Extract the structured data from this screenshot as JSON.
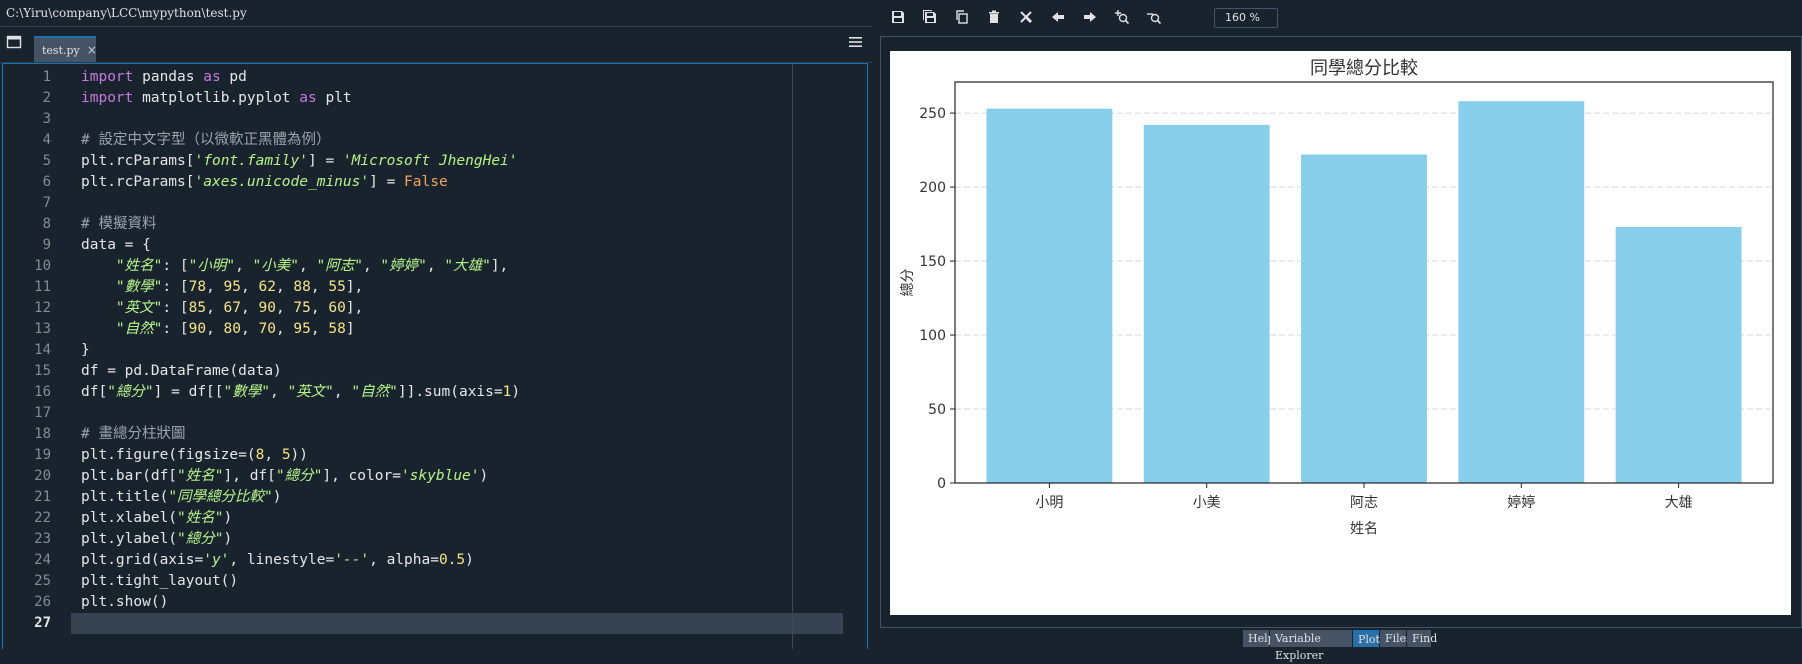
{
  "editor": {
    "file_path": "C:\\Yiru\\company\\LCC\\mypython\\test.py",
    "tab": {
      "label": "test.py",
      "close_glyph": "×"
    },
    "icons": {
      "browse_tabs": "browse-tabs-icon",
      "options": "hamburger-menu-icon"
    },
    "line_numbers": [
      "1",
      "2",
      "3",
      "4",
      "5",
      "6",
      "7",
      "8",
      "9",
      "10",
      "11",
      "12",
      "13",
      "14",
      "15",
      "16",
      "17",
      "18",
      "19",
      "20",
      "21",
      "22",
      "23",
      "24",
      "25",
      "26",
      "27"
    ],
    "current_line": 27,
    "code": [
      [
        {
          "t": "kw",
          "v": "import"
        },
        {
          "t": "p",
          "v": " pandas "
        },
        {
          "t": "kw",
          "v": "as"
        },
        {
          "t": "p",
          "v": " pd"
        }
      ],
      [
        {
          "t": "kw",
          "v": "import"
        },
        {
          "t": "p",
          "v": " matplotlib.pyplot "
        },
        {
          "t": "kw",
          "v": "as"
        },
        {
          "t": "p",
          "v": " plt"
        }
      ],
      [],
      [
        {
          "t": "cmt",
          "v": "# 設定中文字型（以微軟正黑體為例）"
        }
      ],
      [
        {
          "t": "p",
          "v": "plt.rcParams["
        },
        {
          "t": "str",
          "v": "'font.family'"
        },
        {
          "t": "p",
          "v": "] = "
        },
        {
          "t": "str",
          "v": "'Microsoft JhengHei'"
        }
      ],
      [
        {
          "t": "p",
          "v": "plt.rcParams["
        },
        {
          "t": "str",
          "v": "'axes.unicode_minus'"
        },
        {
          "t": "p",
          "v": "] = "
        },
        {
          "t": "bool",
          "v": "False"
        }
      ],
      [],
      [
        {
          "t": "cmt",
          "v": "# 模擬資料"
        }
      ],
      [
        {
          "t": "p",
          "v": "data = {"
        }
      ],
      [
        {
          "t": "p",
          "v": "    "
        },
        {
          "t": "str",
          "v": "\"姓名\""
        },
        {
          "t": "p",
          "v": ": ["
        },
        {
          "t": "str",
          "v": "\"小明\""
        },
        {
          "t": "p",
          "v": ", "
        },
        {
          "t": "str",
          "v": "\"小美\""
        },
        {
          "t": "p",
          "v": ", "
        },
        {
          "t": "str",
          "v": "\"阿志\""
        },
        {
          "t": "p",
          "v": ", "
        },
        {
          "t": "str",
          "v": "\"婷婷\""
        },
        {
          "t": "p",
          "v": ", "
        },
        {
          "t": "str",
          "v": "\"大雄\""
        },
        {
          "t": "p",
          "v": "],"
        }
      ],
      [
        {
          "t": "p",
          "v": "    "
        },
        {
          "t": "str",
          "v": "\"數學\""
        },
        {
          "t": "p",
          "v": ": ["
        },
        {
          "t": "num",
          "v": "78"
        },
        {
          "t": "p",
          "v": ", "
        },
        {
          "t": "num",
          "v": "95"
        },
        {
          "t": "p",
          "v": ", "
        },
        {
          "t": "num",
          "v": "62"
        },
        {
          "t": "p",
          "v": ", "
        },
        {
          "t": "num",
          "v": "88"
        },
        {
          "t": "p",
          "v": ", "
        },
        {
          "t": "num",
          "v": "55"
        },
        {
          "t": "p",
          "v": "],"
        }
      ],
      [
        {
          "t": "p",
          "v": "    "
        },
        {
          "t": "str",
          "v": "\"英文\""
        },
        {
          "t": "p",
          "v": ": ["
        },
        {
          "t": "num",
          "v": "85"
        },
        {
          "t": "p",
          "v": ", "
        },
        {
          "t": "num",
          "v": "67"
        },
        {
          "t": "p",
          "v": ", "
        },
        {
          "t": "num",
          "v": "90"
        },
        {
          "t": "p",
          "v": ", "
        },
        {
          "t": "num",
          "v": "75"
        },
        {
          "t": "p",
          "v": ", "
        },
        {
          "t": "num",
          "v": "60"
        },
        {
          "t": "p",
          "v": "],"
        }
      ],
      [
        {
          "t": "p",
          "v": "    "
        },
        {
          "t": "str",
          "v": "\"自然\""
        },
        {
          "t": "p",
          "v": ": ["
        },
        {
          "t": "num",
          "v": "90"
        },
        {
          "t": "p",
          "v": ", "
        },
        {
          "t": "num",
          "v": "80"
        },
        {
          "t": "p",
          "v": ", "
        },
        {
          "t": "num",
          "v": "70"
        },
        {
          "t": "p",
          "v": ", "
        },
        {
          "t": "num",
          "v": "95"
        },
        {
          "t": "p",
          "v": ", "
        },
        {
          "t": "num",
          "v": "58"
        },
        {
          "t": "p",
          "v": "]"
        }
      ],
      [
        {
          "t": "p",
          "v": "}"
        }
      ],
      [
        {
          "t": "p",
          "v": "df = pd.DataFrame(data)"
        }
      ],
      [
        {
          "t": "p",
          "v": "df["
        },
        {
          "t": "str",
          "v": "\"總分\""
        },
        {
          "t": "p",
          "v": "] = df[["
        },
        {
          "t": "str",
          "v": "\"數學\""
        },
        {
          "t": "p",
          "v": ", "
        },
        {
          "t": "str",
          "v": "\"英文\""
        },
        {
          "t": "p",
          "v": ", "
        },
        {
          "t": "str",
          "v": "\"自然\""
        },
        {
          "t": "p",
          "v": "]].sum(axis="
        },
        {
          "t": "num",
          "v": "1"
        },
        {
          "t": "p",
          "v": ")"
        }
      ],
      [],
      [
        {
          "t": "cmt",
          "v": "# 畫總分柱狀圖"
        }
      ],
      [
        {
          "t": "p",
          "v": "plt.figure(figsize=("
        },
        {
          "t": "num",
          "v": "8"
        },
        {
          "t": "p",
          "v": ", "
        },
        {
          "t": "num",
          "v": "5"
        },
        {
          "t": "p",
          "v": "))"
        }
      ],
      [
        {
          "t": "p",
          "v": "plt.bar(df["
        },
        {
          "t": "str",
          "v": "\"姓名\""
        },
        {
          "t": "p",
          "v": "], df["
        },
        {
          "t": "str",
          "v": "\"總分\""
        },
        {
          "t": "p",
          "v": "], color="
        },
        {
          "t": "str",
          "v": "'skyblue'"
        },
        {
          "t": "p",
          "v": ")"
        }
      ],
      [
        {
          "t": "p",
          "v": "plt.title("
        },
        {
          "t": "str",
          "v": "\"同學總分比較\""
        },
        {
          "t": "p",
          "v": ")"
        }
      ],
      [
        {
          "t": "p",
          "v": "plt.xlabel("
        },
        {
          "t": "str",
          "v": "\"姓名\""
        },
        {
          "t": "p",
          "v": ")"
        }
      ],
      [
        {
          "t": "p",
          "v": "plt.ylabel("
        },
        {
          "t": "str",
          "v": "\"總分\""
        },
        {
          "t": "p",
          "v": ")"
        }
      ],
      [
        {
          "t": "p",
          "v": "plt.grid(axis="
        },
        {
          "t": "str",
          "v": "'y'"
        },
        {
          "t": "p",
          "v": ", linestyle="
        },
        {
          "t": "str",
          "v": "'--'"
        },
        {
          "t": "p",
          "v": ", alpha="
        },
        {
          "t": "num",
          "v": "0.5"
        },
        {
          "t": "p",
          "v": ")"
        }
      ],
      [
        {
          "t": "p",
          "v": "plt.tight_layout()"
        }
      ],
      [
        {
          "t": "p",
          "v": "plt.show()"
        }
      ],
      []
    ],
    "colors": {
      "keyword": "#c678dd",
      "string": "#b5f38a",
      "number": "#f5e387",
      "comment": "#9aa3ab",
      "boolean": "#f0a55a",
      "plain": "#e6e6e6"
    }
  },
  "plots": {
    "toolbar": [
      {
        "name": "save-plot-button",
        "icon": "save-icon"
      },
      {
        "name": "save-all-plots-button",
        "icon": "save-all-icon"
      },
      {
        "name": "copy-plot-button",
        "icon": "copy-icon"
      },
      {
        "name": "remove-plot-button",
        "icon": "trash-icon"
      },
      {
        "name": "remove-all-plots-button",
        "icon": "remove-all-icon"
      },
      {
        "name": "previous-plot-button",
        "icon": "arrow-left-icon"
      },
      {
        "name": "next-plot-button",
        "icon": "arrow-right-icon"
      },
      {
        "name": "zoom-in-button",
        "icon": "zoom-in-icon"
      },
      {
        "name": "zoom-out-button",
        "icon": "zoom-out-icon"
      }
    ],
    "zoom_level": "160 %",
    "bottom_tabs": [
      {
        "label": "Help",
        "active": false
      },
      {
        "label": "Variable Explorer",
        "active": false
      },
      {
        "label": "Plots",
        "active": true
      },
      {
        "label": "Files",
        "active": false
      },
      {
        "label": "Find",
        "active": false
      }
    ]
  },
  "chart_data": {
    "type": "bar",
    "title": "同學總分比較",
    "xlabel": "姓名",
    "ylabel": "總分",
    "categories": [
      "小明",
      "小美",
      "阿志",
      "婷婷",
      "大雄"
    ],
    "values": [
      253,
      242,
      222,
      258,
      173
    ],
    "ylim": [
      0,
      271
    ],
    "yticks": [
      0,
      50,
      100,
      150,
      200,
      250
    ],
    "grid": "y-dashed",
    "bar_color": "#87ceeb"
  }
}
